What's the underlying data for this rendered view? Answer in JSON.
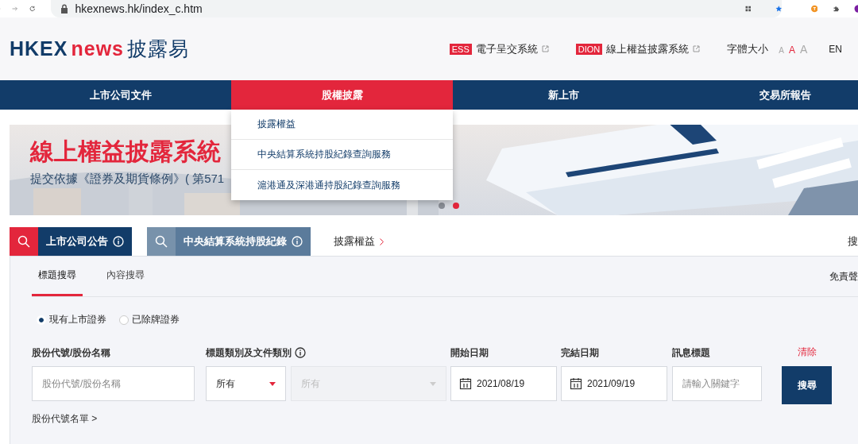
{
  "browser": {
    "url": "hkexnews.hk/index_c.htm"
  },
  "header": {
    "logo": {
      "brand": "HKEX",
      "product": "news",
      "local_name": "披露易"
    },
    "links": [
      {
        "tag": "ESS",
        "label": "電子呈交系統"
      },
      {
        "tag": "DION",
        "label": "線上權益披露系統"
      }
    ],
    "font_size": {
      "label": "字體大小",
      "options": [
        {
          "label": "A",
          "selected": false
        },
        {
          "label": "A",
          "selected": true
        },
        {
          "label": "A",
          "selected": false
        }
      ]
    },
    "language": "EN"
  },
  "nav": [
    {
      "label": "上市公司文件",
      "selected": false
    },
    {
      "label": "股權披露",
      "selected": true
    },
    {
      "label": "新上市",
      "selected": false
    },
    {
      "label": "交易所報告",
      "selected": false
    }
  ],
  "dropdown": [
    "披露權益",
    "中央結算系統持股紀錄查詢服務",
    "滬港通及深港通持股紀錄查詢服務"
  ],
  "banner": {
    "title": "線上權益披露系統",
    "subtitle": "提交依據《證券及期貨條例》( 第571",
    "slides": [
      {
        "selected": false
      },
      {
        "selected": true
      }
    ]
  },
  "quick_search": [
    {
      "label": "上市公司公告",
      "selected": true
    },
    {
      "label": "中央結算系統持股紀錄",
      "selected": false
    }
  ],
  "quick_link": "披露權益",
  "edge_text": "搜",
  "panel": {
    "tabs": [
      {
        "label": "標題搜尋",
        "selected": true
      },
      {
        "label": "內容搜尋",
        "selected": false
      }
    ],
    "disclaimer": "免責聲",
    "radios": [
      {
        "label": "現有上市證券",
        "selected": true
      },
      {
        "label": "已除牌證券",
        "selected": false
      }
    ],
    "filters": [
      {
        "label": "股份代號/股份名稱",
        "controls": [
          {
            "kind": "text",
            "placeholder": "股份代號/股份名稱"
          }
        ]
      },
      {
        "label": "標題類別及文件類別",
        "info": true,
        "controls": [
          {
            "kind": "select",
            "value": "所有",
            "disabled": false
          },
          {
            "kind": "select",
            "value": "所有",
            "disabled": true
          }
        ]
      },
      {
        "label": "開始日期",
        "controls": [
          {
            "kind": "date",
            "value": "2021/08/19"
          }
        ]
      },
      {
        "label": "完結日期",
        "controls": [
          {
            "kind": "date",
            "value": "2021/09/19"
          }
        ]
      },
      {
        "label": "訊息標題",
        "controls": [
          {
            "kind": "text",
            "placeholder": "請輸入關鍵字"
          }
        ]
      }
    ],
    "clear": "清除",
    "search": "搜尋",
    "stock_list_link": "股份代號名單 >"
  }
}
